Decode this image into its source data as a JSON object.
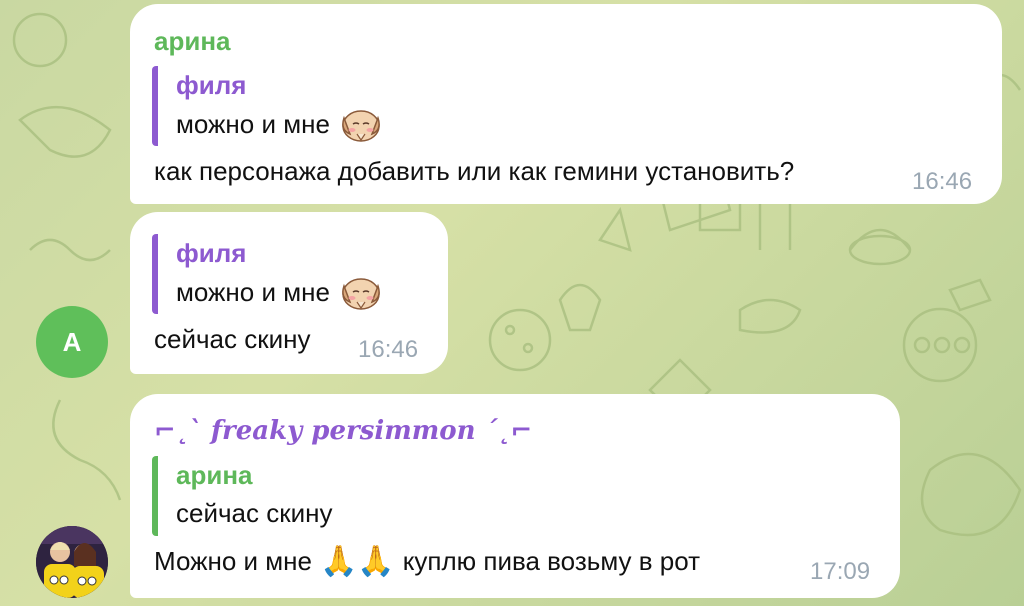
{
  "colors": {
    "green_sender": "#5eb85a",
    "purple_sender": "#8d5ad0",
    "time": "#9aa7b3",
    "bubble": "#ffffff",
    "avatar_a": "#5fbf5a"
  },
  "messages": [
    {
      "sender": "арина",
      "reply": {
        "name": "филя",
        "text": "можно и мне",
        "sticker": "dog-sticker-icon"
      },
      "text": "как персонажа добавить или как гемини установить?",
      "time": "16:46"
    },
    {
      "reply": {
        "name": "филя",
        "text": "можно и мне",
        "sticker": "dog-sticker-icon"
      },
      "text": "сейчас скину",
      "time": "16:46",
      "avatar_letter": "A"
    },
    {
      "sender": "⌐˛` 𝒇𝒓𝒆𝒂𝒌𝒚 𝒑𝒆𝒓𝒔𝒊𝒎𝒎𝒐𝒏 ´˛⌐",
      "reply": {
        "name": "арина",
        "text": "сейчас скину"
      },
      "text_before": "Можно и мне",
      "emoji": "🙏🙏",
      "text_after": "куплю пива возьму в рот",
      "time": "17:09",
      "avatar": "photo-avatar"
    }
  ]
}
